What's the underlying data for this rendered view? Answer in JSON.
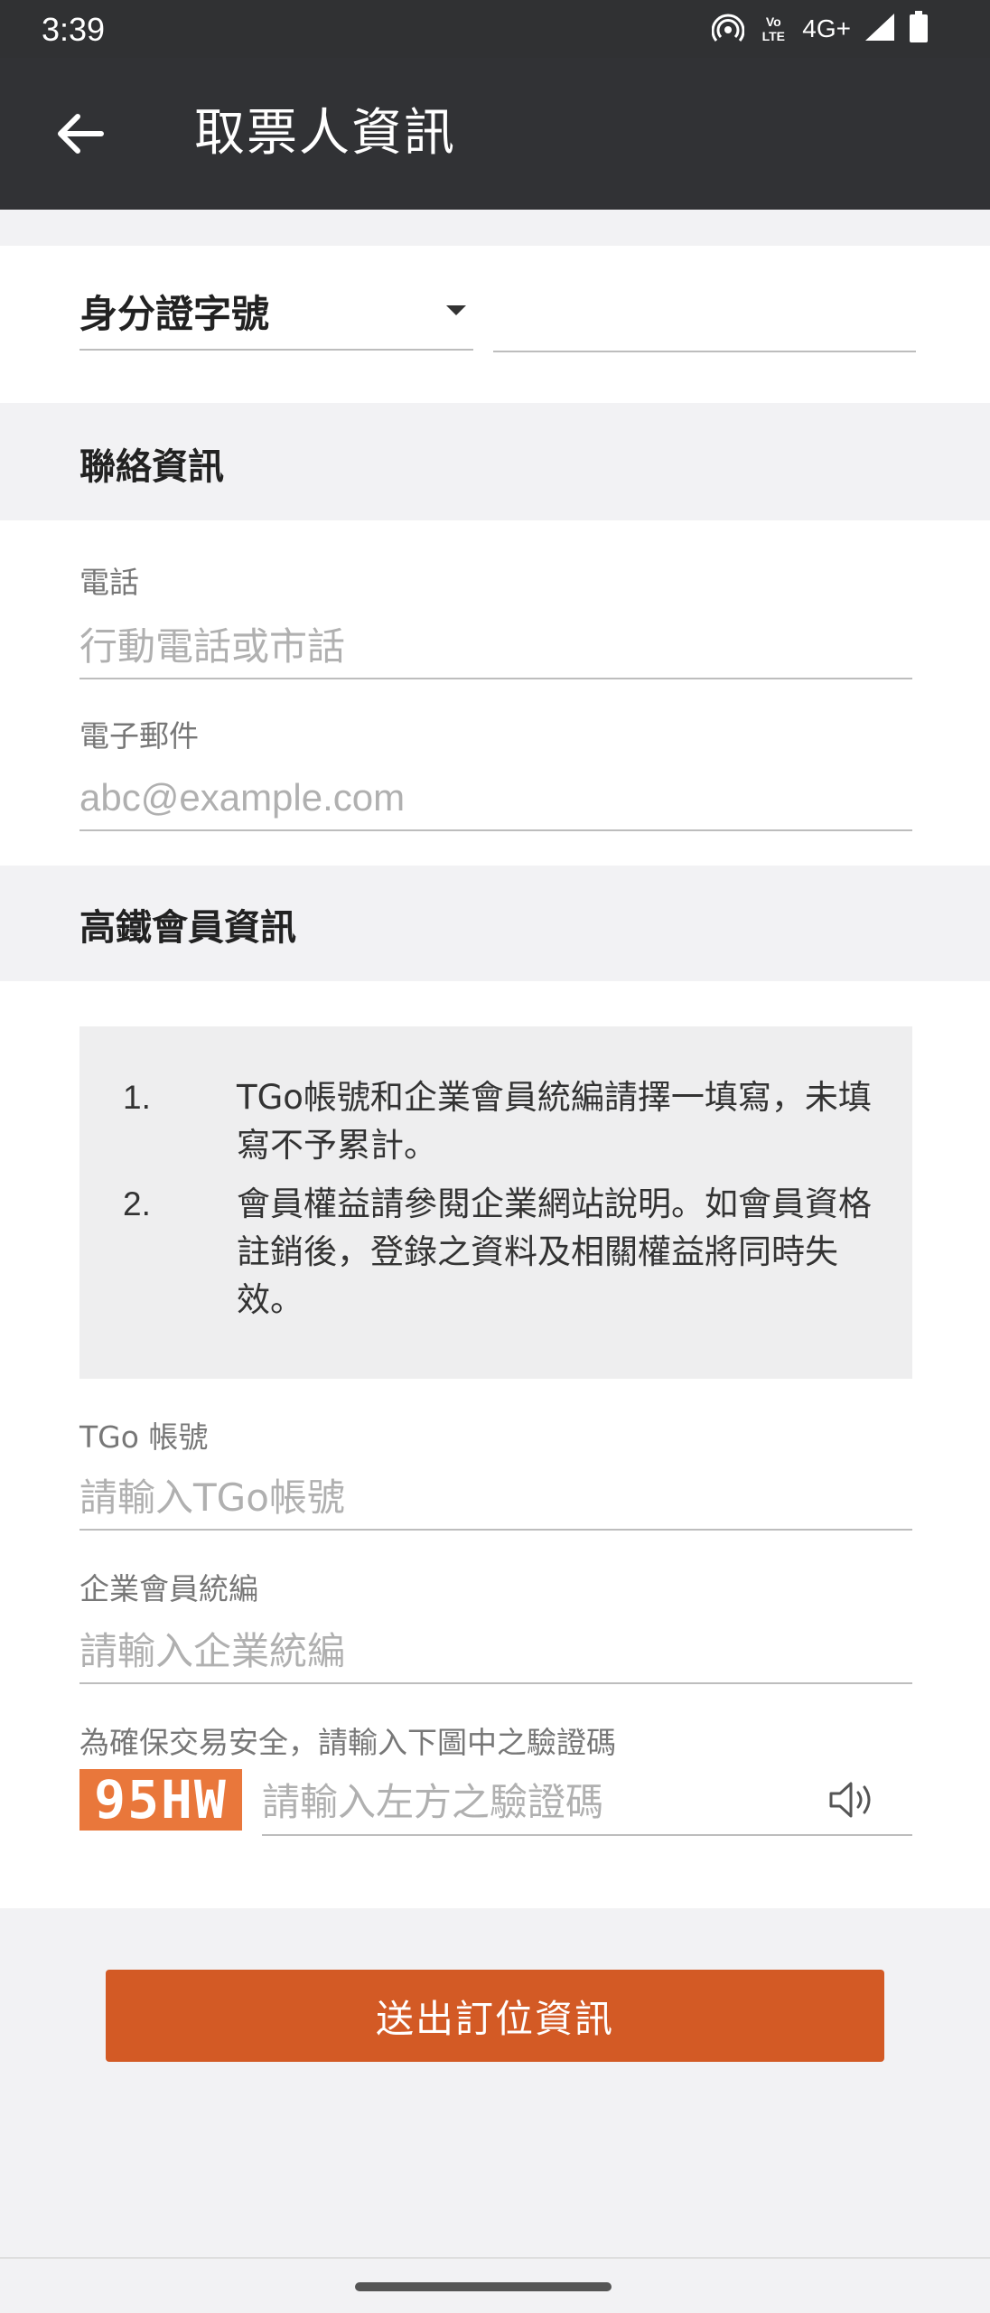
{
  "status_bar": {
    "time": "3:39",
    "network": "4G+",
    "volte": "Vo LTE",
    "icons": [
      "hotspot-icon",
      "volte-icon",
      "signal-icon",
      "battery-icon"
    ]
  },
  "app_bar": {
    "title": "取票人資訊",
    "back_icon": "arrow-left-icon"
  },
  "id_section": {
    "id_type": "身分證字號",
    "id_value": ""
  },
  "contact": {
    "title": "聯絡資訊",
    "phone_label": "電話",
    "phone_placeholder": "行動電話或市話",
    "email_label": "電子郵件",
    "email_placeholder": "abc@example.com"
  },
  "member": {
    "title": "高鐵會員資訊",
    "notices": [
      {
        "num": "1.",
        "text": "TGo帳號和企業會員統編請擇一填寫，未填寫不予累計。"
      },
      {
        "num": "2.",
        "text": "會員權益請參閱企業網站說明。如會員資格註銷後，登錄之資料及相關權益將同時失效。"
      }
    ],
    "tgo_label": "TGo 帳號",
    "tgo_placeholder": "請輸入TGo帳號",
    "company_label": "企業會員統編",
    "company_placeholder": "請輸入企業統編",
    "captcha_label": "為確保交易安全，請輸入下圖中之驗證碼",
    "captcha_code": "95HW",
    "captcha_placeholder": "請輸入左方之驗證碼",
    "audio_icon": "speaker-icon"
  },
  "submit": {
    "label": "送出訂位資訊"
  },
  "colors": {
    "app_bar": "#313235",
    "accent": "#d35a25",
    "captcha_bg": "#e9773b",
    "section_bg": "#f2f2f4"
  }
}
